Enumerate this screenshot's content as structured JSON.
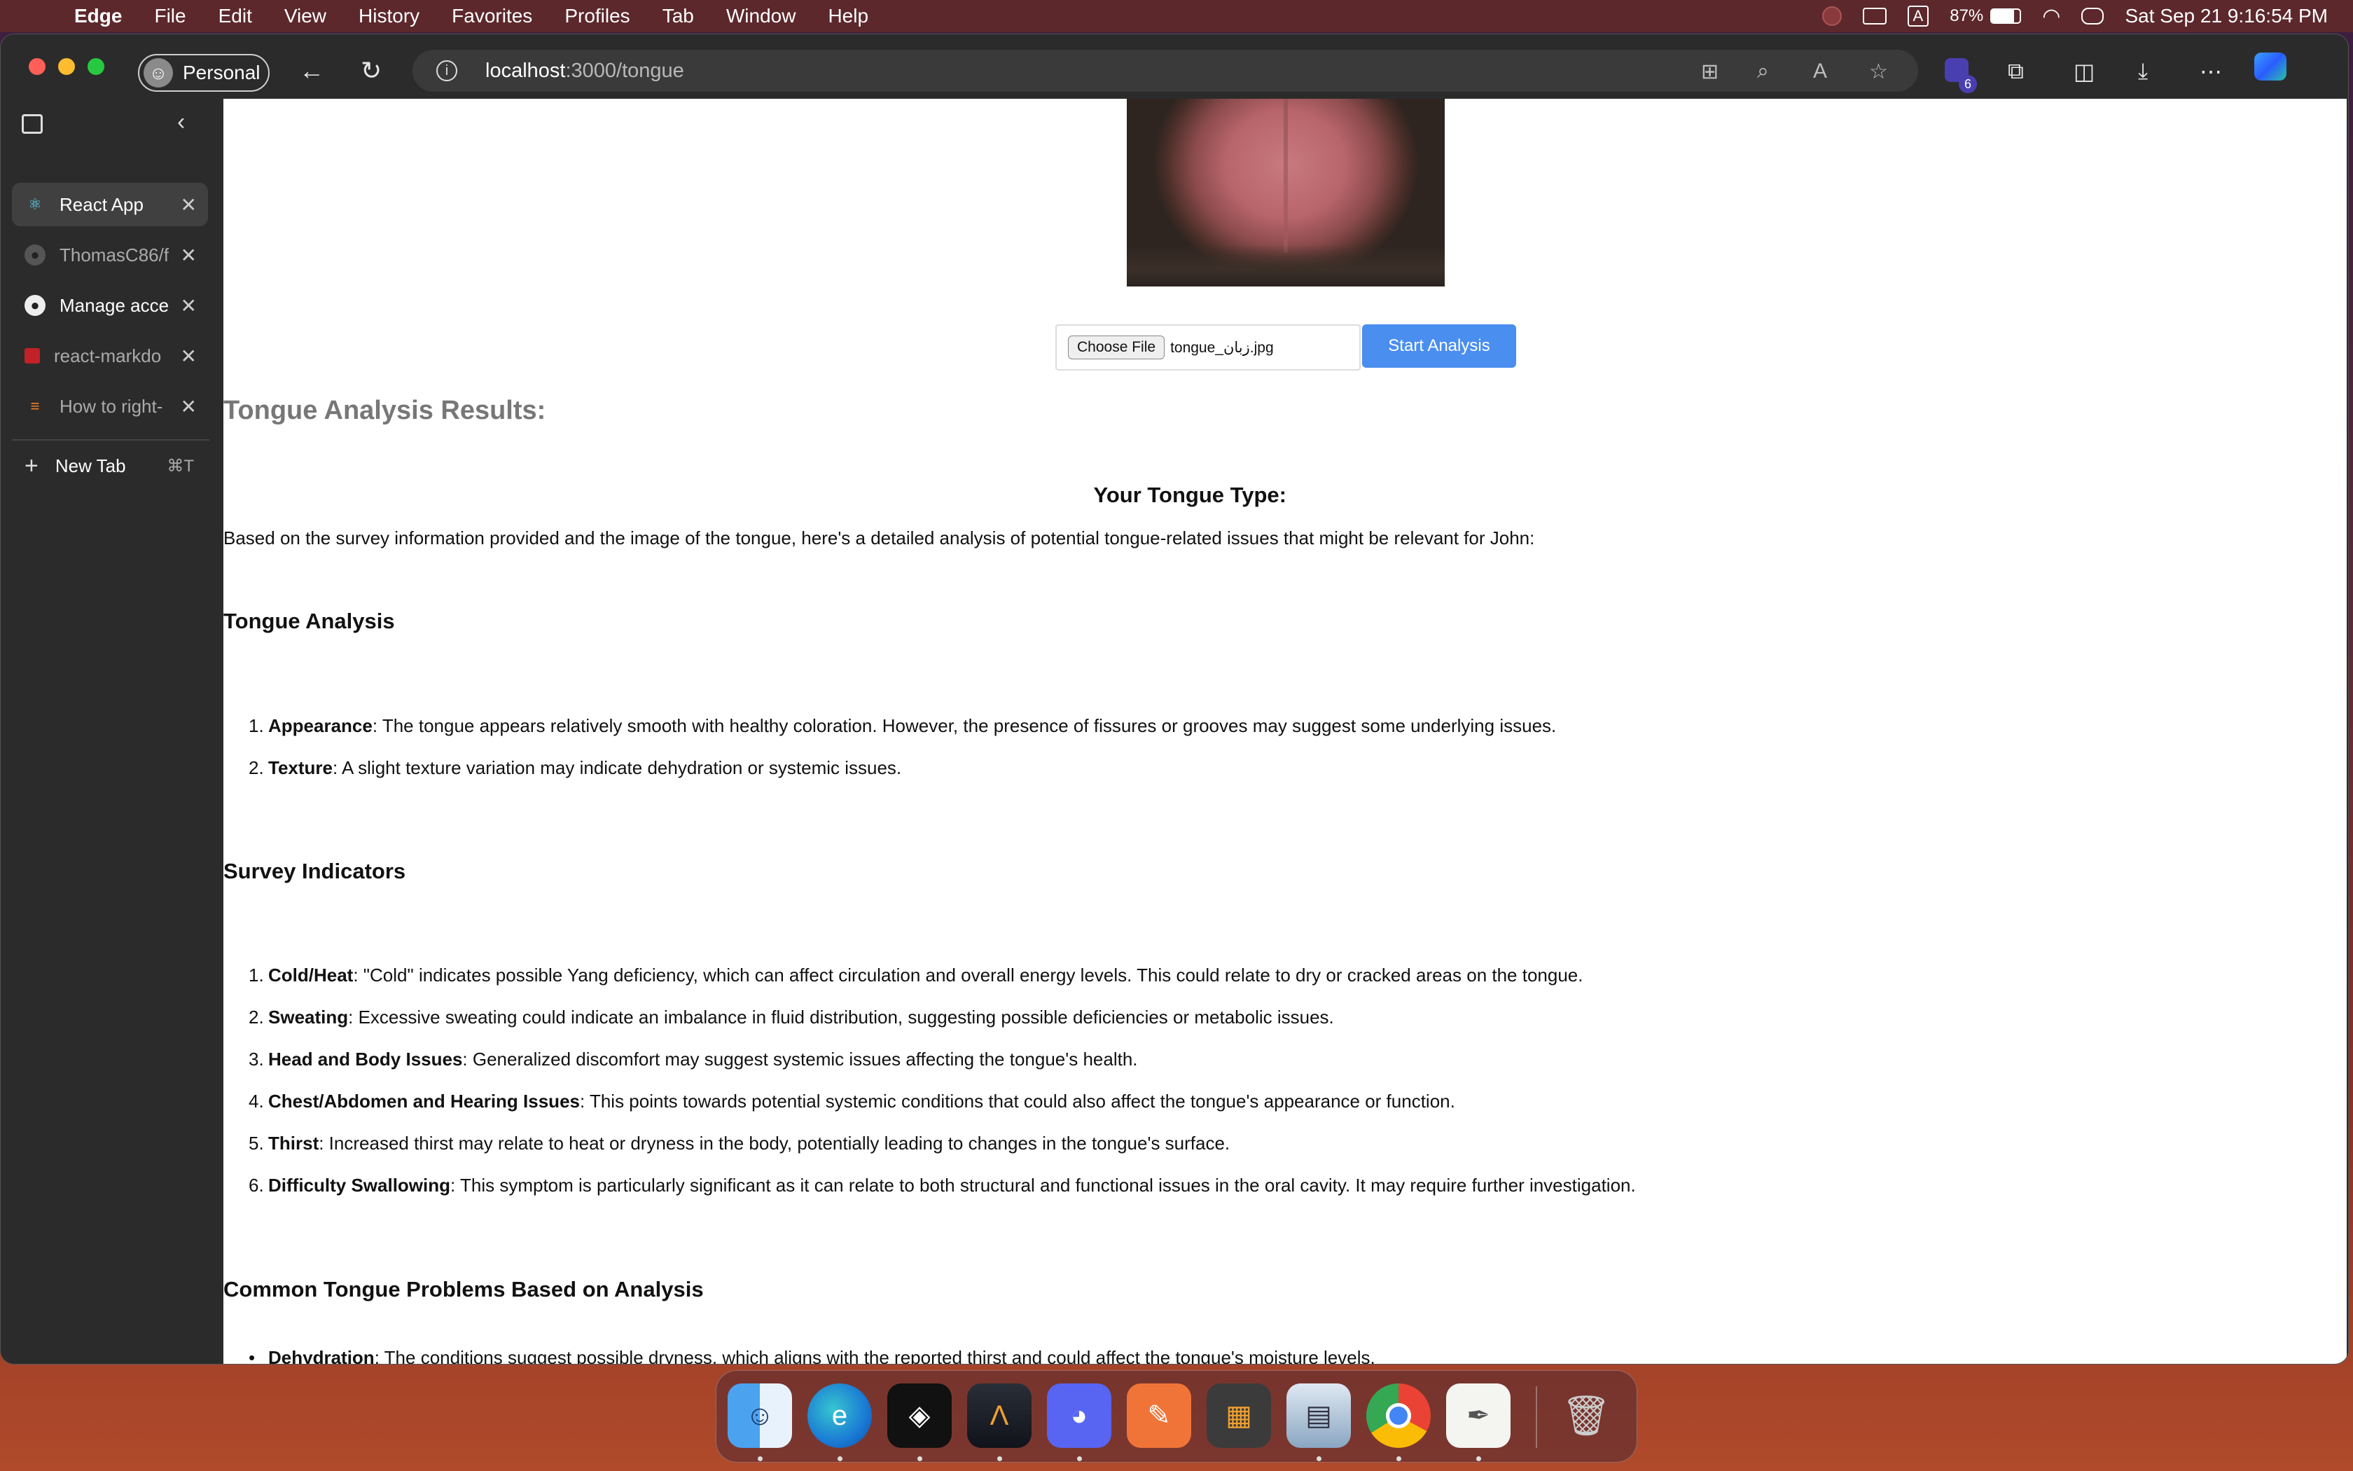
{
  "menubar": {
    "app_name": "Edge",
    "menus": [
      "File",
      "Edit",
      "View",
      "History",
      "Favorites",
      "Profiles",
      "Tab",
      "Window",
      "Help"
    ],
    "battery": "87%",
    "clock": "Sat Sep 21  9:16:54 PM",
    "input_indicator": "A"
  },
  "browser": {
    "profile_label": "Personal",
    "url_host": "localhost",
    "url_path": ":3000/tongue",
    "extension_badge": "6"
  },
  "sidebar": {
    "tabs": [
      {
        "label": "React App",
        "icon": "react-icon",
        "active": true
      },
      {
        "label": "ThomasC86/f",
        "icon": "github-icon",
        "active": false
      },
      {
        "label": "Manage acce",
        "icon": "github-icon",
        "active": false
      },
      {
        "label": "react-markdo",
        "icon": "npm-icon",
        "active": false
      },
      {
        "label": "How to right-",
        "icon": "stackoverflow-icon",
        "active": false
      }
    ],
    "new_tab_label": "New Tab",
    "new_tab_shortcut": "⌘T"
  },
  "page": {
    "choose_file_label": "Choose File",
    "file_name": "tongue_زبان.jpg",
    "start_button": "Start Analysis",
    "results_title": "Tongue Analysis Results:",
    "type_title": "Your Tongue Type:",
    "intro": "Based on the survey information provided and the image of the tongue, here's a detailed analysis of potential tongue-related issues that might be relevant for John:",
    "tongue_analysis": {
      "heading": "Tongue Analysis",
      "items": [
        {
          "term": "Appearance",
          "text": ": The tongue appears relatively smooth with healthy coloration. However, the presence of fissures or grooves may suggest some underlying issues."
        },
        {
          "term": "Texture",
          "text": ": A slight texture variation may indicate dehydration or systemic issues."
        }
      ]
    },
    "survey": {
      "heading": "Survey Indicators",
      "items": [
        {
          "term": "Cold/Heat",
          "text": ": \"Cold\" indicates possible Yang deficiency, which can affect circulation and overall energy levels. This could relate to dry or cracked areas on the tongue."
        },
        {
          "term": "Sweating",
          "text": ": Excessive sweating could indicate an imbalance in fluid distribution, suggesting possible deficiencies or metabolic issues."
        },
        {
          "term": "Head and Body Issues",
          "text": ": Generalized discomfort may suggest systemic issues affecting the tongue's health."
        },
        {
          "term": "Chest/Abdomen and Hearing Issues",
          "text": ": This points towards potential systemic conditions that could also affect the tongue's appearance or function."
        },
        {
          "term": "Thirst",
          "text": ": Increased thirst may relate to heat or dryness in the body, potentially leading to changes in the tongue's surface."
        },
        {
          "term": "Difficulty Swallowing",
          "text": ": This symptom is particularly significant as it can relate to both structural and functional issues in the oral cavity. It may require further investigation."
        }
      ]
    },
    "common": {
      "heading": "Common Tongue Problems Based on Analysis",
      "items": [
        {
          "term": "Dehydration",
          "text": ": The conditions suggest possible dryness, which aligns with the reported thirst and could affect the tongue's moisture levels."
        }
      ]
    }
  },
  "dock": {
    "apps": [
      "finder-icon",
      "edge-icon",
      "unity-icon",
      "affinity-icon",
      "discord-icon",
      "pen-icon",
      "calculator-icon",
      "preview-icon",
      "chrome-icon",
      "textedit-icon",
      "trash-icon"
    ]
  },
  "colors": {
    "accent_button": "#4a8ef0",
    "sidebar_bg": "#2b2b2b"
  }
}
